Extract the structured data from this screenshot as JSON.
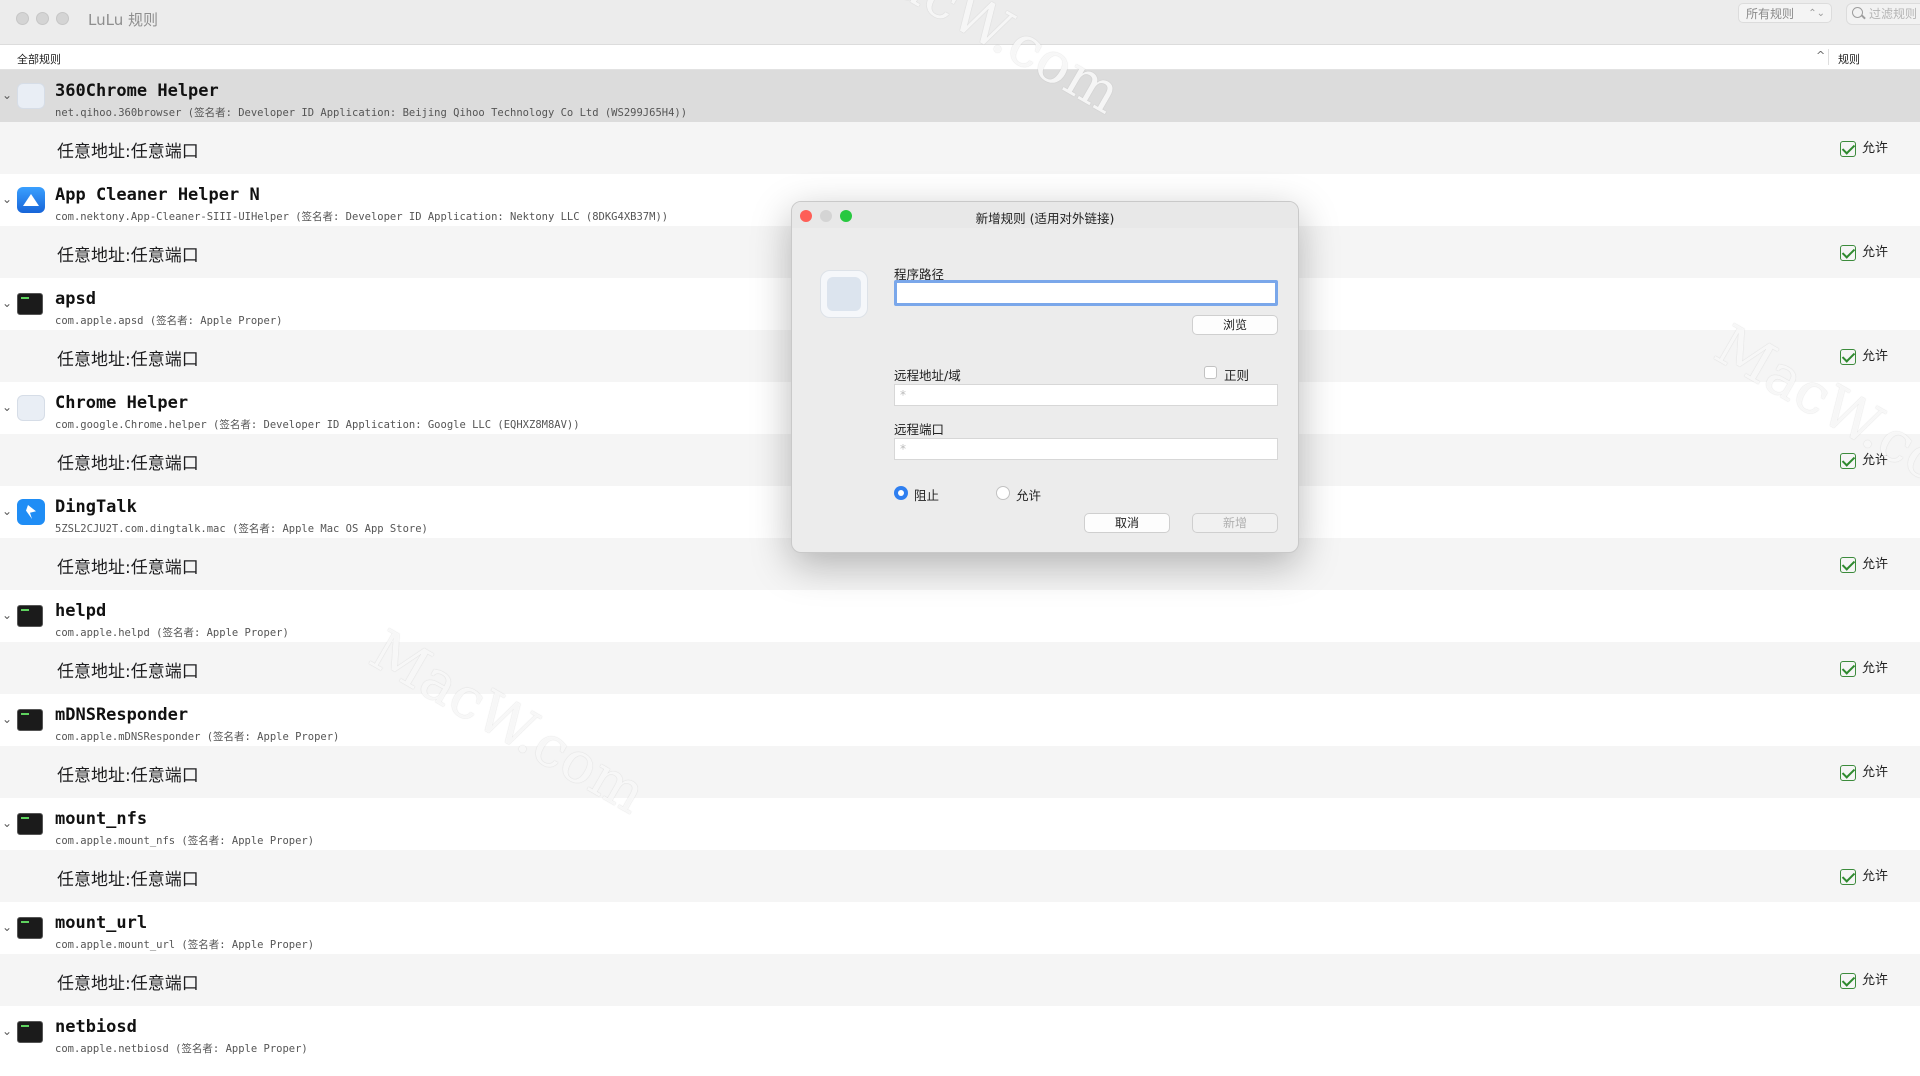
{
  "window": {
    "title": "LuLu 规则",
    "filter_select": "所有规则",
    "search_placeholder": "过滤规则"
  },
  "columns": {
    "left": "全部规则",
    "right": "规则"
  },
  "apps": [
    {
      "name": "360Chrome Helper",
      "sub": "net.qihoo.360browser (签名者: Developer ID Application: Beijing Qihoo Technology Co Ltd (WS299J65H4))",
      "icon": "placeholder-app-icon",
      "selected": true
    },
    {
      "name": "App Cleaner Helper N",
      "sub": "com.nektony.App-Cleaner-SIII-UIHelper (签名者: Developer ID Application: Nektony LLC (8DKG4XB37M))",
      "icon": "app-cleaner-icon"
    },
    {
      "name": "apsd",
      "sub": "com.apple.apsd (签名者: Apple Proper)",
      "icon": "terminal-icon"
    },
    {
      "name": "Chrome Helper",
      "sub": "com.google.Chrome.helper (签名者: Developer ID Application: Google LLC (EQHXZ8M8AV))",
      "icon": "placeholder-app-icon"
    },
    {
      "name": "DingTalk",
      "sub": "5ZSL2CJU2T.com.dingtalk.mac (签名者: Apple Mac OS App Store)",
      "icon": "dingtalk-icon"
    },
    {
      "name": "helpd",
      "sub": "com.apple.helpd (签名者: Apple Proper)",
      "icon": "terminal-icon"
    },
    {
      "name": "mDNSResponder",
      "sub": "com.apple.mDNSResponder (签名者: Apple Proper)",
      "icon": "terminal-icon"
    },
    {
      "name": "mount_nfs",
      "sub": "com.apple.mount_nfs (签名者: Apple Proper)",
      "icon": "terminal-icon"
    },
    {
      "name": "mount_url",
      "sub": "com.apple.mount_url (签名者: Apple Proper)",
      "icon": "terminal-icon"
    },
    {
      "name": "netbiosd",
      "sub": "com.apple.netbiosd (签名者: Apple Proper)",
      "icon": "terminal-icon"
    }
  ],
  "rule": {
    "text": "任意地址:任意端口",
    "action": "允许"
  },
  "dialog": {
    "title": "新增规则 (适用对外链接)",
    "path_label": "程序路径",
    "path_value": "",
    "browse_button": "浏览",
    "remote_label": "远程地址/域",
    "regex_label": "正则",
    "remote_placeholder": "*",
    "port_label": "远程端口",
    "port_placeholder": "*",
    "block_label": "阻止",
    "allow_label": "允许",
    "selected_action": "阻止",
    "cancel_button": "取消",
    "add_button": "新增"
  },
  "watermark": "MacW.com",
  "colors": {
    "accent": "#2f7ff0",
    "close": "#fe5f57",
    "min": "#d4d4d4",
    "zoom": "#28c840",
    "allow_check": "#2f8a2f"
  }
}
